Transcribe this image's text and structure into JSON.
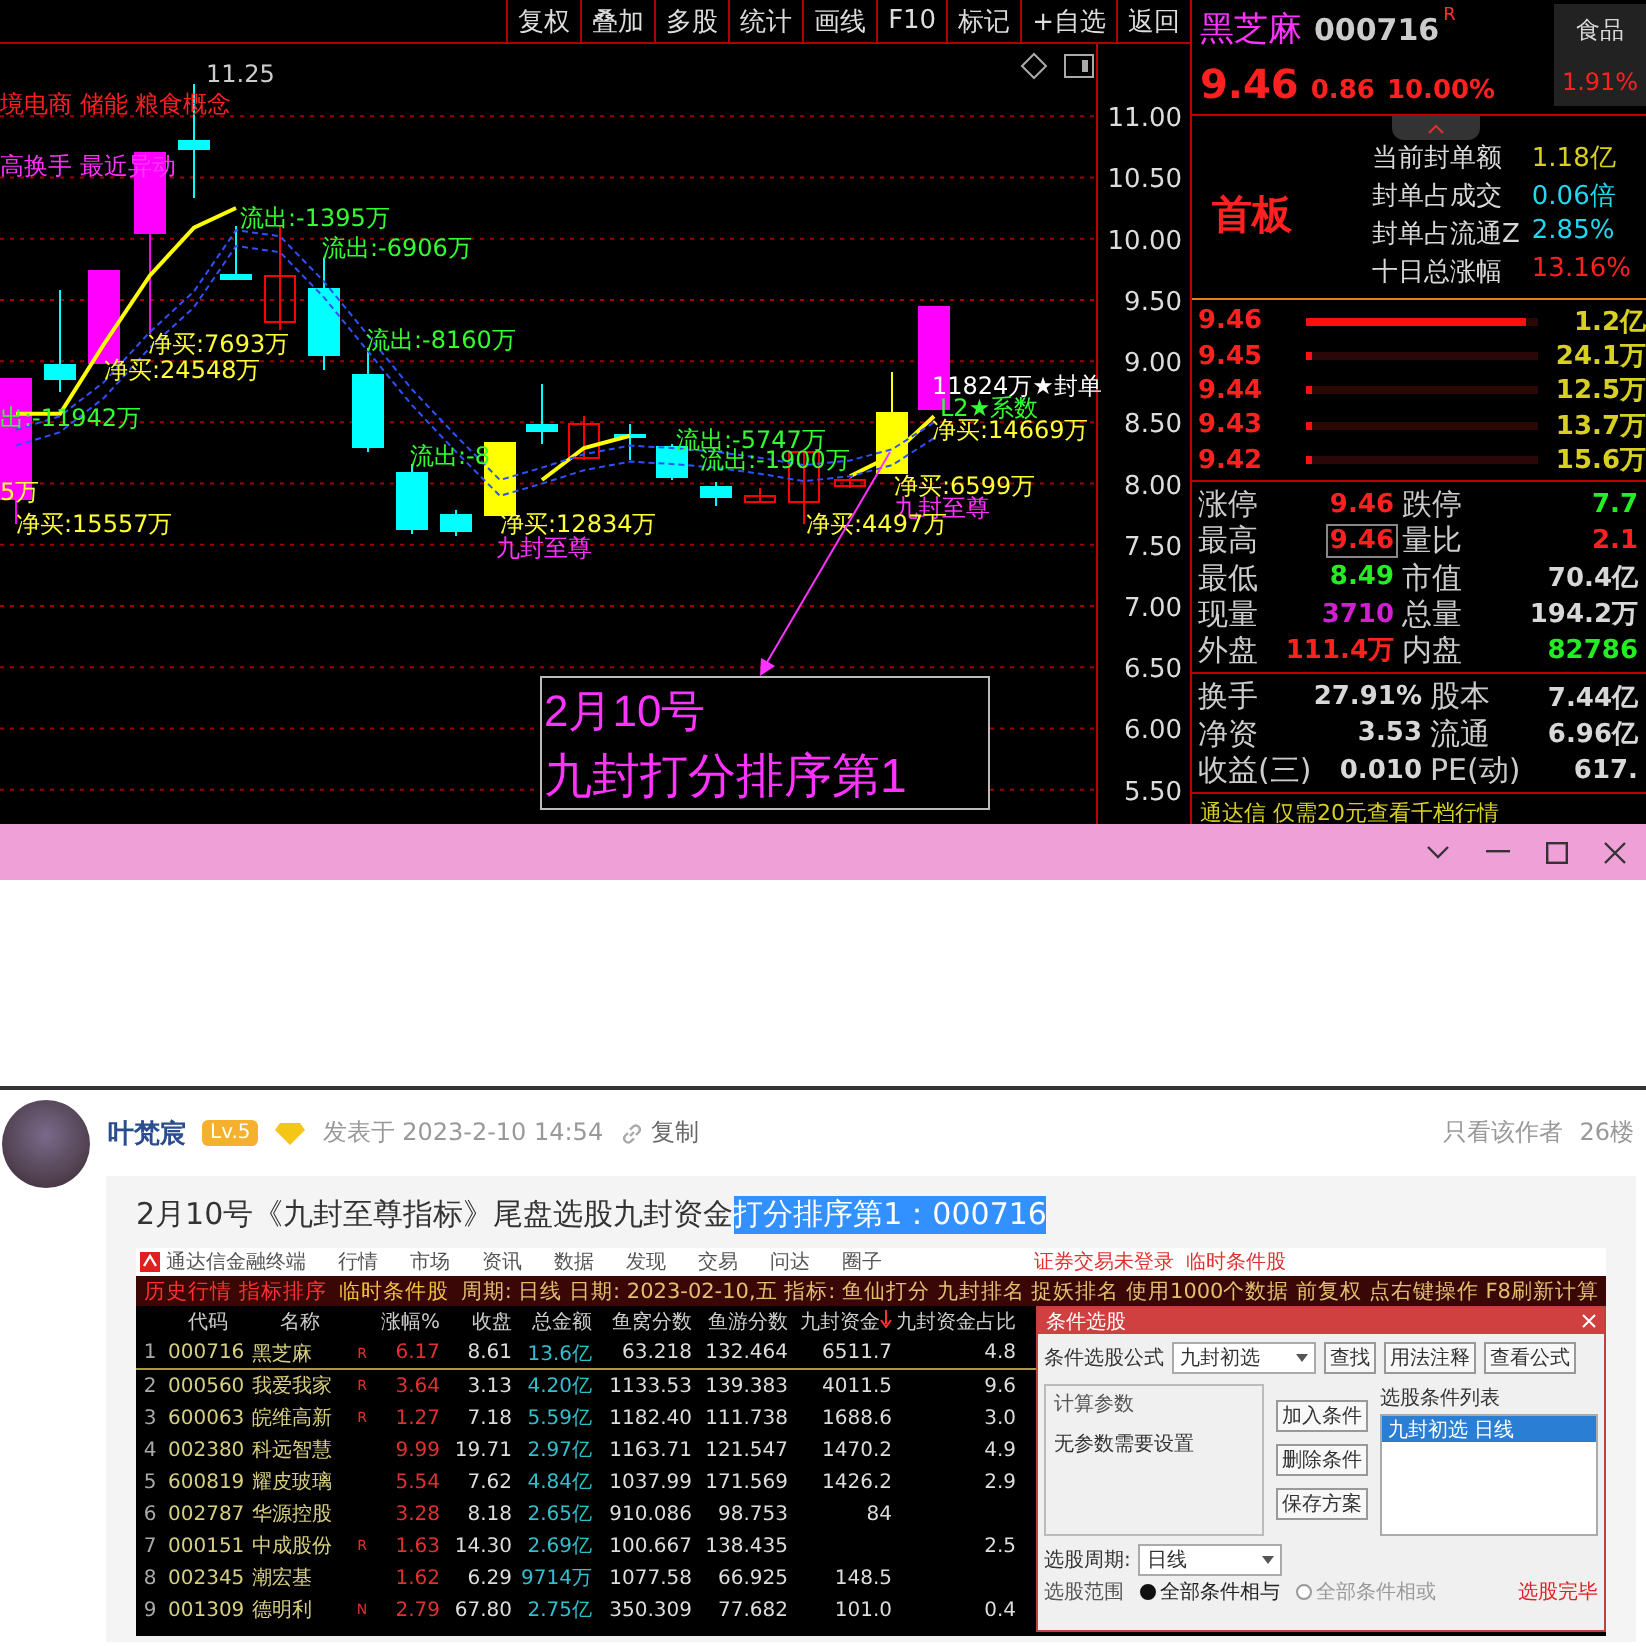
{
  "toolbar": {
    "buttons": [
      "复权",
      "叠加",
      "多股",
      "统计",
      "画线",
      "F10",
      "标记",
      "+自选",
      "返回"
    ]
  },
  "chart": {
    "chart_data": {
      "type": "line",
      "ylim": [
        5.22,
        11.59
      ],
      "grid": true,
      "yticks": [
        {
          "value": 11,
          "label": "11.00"
        },
        {
          "value": 10.5,
          "label": "10.50"
        },
        {
          "value": 10,
          "label": "10.00"
        },
        {
          "value": 9.5,
          "label": "9.50"
        },
        {
          "value": 9,
          "label": "9.00"
        },
        {
          "value": 8.5,
          "label": "8.50"
        },
        {
          "value": 8,
          "label": "8.00"
        },
        {
          "value": 7.5,
          "label": "7.50"
        },
        {
          "value": 7,
          "label": "7.00"
        },
        {
          "value": 6.5,
          "label": "6.50"
        },
        {
          "value": 6,
          "label": "6.00"
        },
        {
          "value": 5.5,
          "label": "5.50"
        }
      ],
      "series": [
        {
          "color": "#ffff00",
          "line_style": "solid",
          "values": [
            8.57,
            8.57,
            9.14,
            9.7,
            10.09,
            10.25,
            null,
            null,
            null,
            null,
            null,
            null,
            8.03,
            8.29,
            8.39,
            null,
            null,
            null,
            null,
            8.06,
            8.23,
            8.55
          ]
        },
        {
          "color": "#3050ff",
          "line_style": "dashed",
          "values": [
            8.44,
            8.55,
            8.83,
            9.24,
            9.57,
            10.07,
            10.02,
            9.65,
            9.21,
            8.77,
            8.39,
            8.03,
            8.13,
            8.24,
            8.31,
            8.29,
            8.26,
            8.21,
            8.15,
            8.19,
            8.28,
            8.5
          ]
        },
        {
          "color": "#3050ff",
          "line_style": "dashed",
          "values": [
            8.31,
            8.42,
            8.7,
            9.11,
            9.44,
            9.94,
            9.89,
            9.52,
            9.08,
            8.64,
            8.26,
            7.9,
            8.0,
            8.11,
            8.18,
            8.16,
            8.13,
            8.08,
            8.02,
            8.06,
            8.15,
            8.37
          ]
        }
      ]
    },
    "tags": [
      {
        "text": "境电商 储能 粮食概念",
        "kind": "concept"
      },
      {
        "text": "高换手 最近异动",
        "kind": "hot"
      }
    ],
    "high_label": "11.25",
    "annotations": [
      {
        "text": "流出:-1395万",
        "kind": "outflow"
      },
      {
        "text": "流出:-6906万",
        "kind": "outflow"
      },
      {
        "text": "净买:7693万",
        "kind": "netbuy"
      },
      {
        "text": "流出:-8160万",
        "kind": "outflow"
      },
      {
        "text": "净买:24548万",
        "kind": "netbuy"
      },
      {
        "text": "11824万★封单",
        "kind": "seal"
      },
      {
        "text": "L2★系数",
        "kind": "coef"
      },
      {
        "text": "出:-11942万",
        "kind": "outflow"
      },
      {
        "text": "流出:-5747万",
        "kind": "outflow"
      },
      {
        "text": "净买:14669万",
        "kind": "netbuy"
      },
      {
        "text": "流出:-8",
        "kind": "outflow"
      },
      {
        "text": "流出:-1900万",
        "kind": "outflow"
      },
      {
        "text": "净买:6599万",
        "kind": "netbuy"
      },
      {
        "text": "5万",
        "kind": "netbuy"
      },
      {
        "text": "九封至尊",
        "kind": "signal"
      },
      {
        "text": "净买:15557万",
        "kind": "netbuy"
      },
      {
        "text": "净买:12834万",
        "kind": "netbuy"
      },
      {
        "text": "净买:4497万",
        "kind": "netbuy"
      },
      {
        "text": "九封至尊",
        "kind": "signal"
      }
    ],
    "callout": [
      "2月10号",
      "九封打分排序第1"
    ]
  },
  "quote": {
    "name": "黑芝麻",
    "code": "000716",
    "flag": "R",
    "price": "9.46",
    "change": "0.86",
    "percent": "10.00%",
    "sector": {
      "name": "食品",
      "percent": "1.91%"
    },
    "board": "首板",
    "metrics": [
      {
        "label": "当前封单额",
        "value": "1.18亿",
        "color": "#d8d020"
      },
      {
        "label": "封单占成交",
        "value": "0.06倍",
        "color": "#22d8ee"
      },
      {
        "label": "封单占流通Z",
        "value": "2.85%",
        "color": "#22d8ee"
      },
      {
        "label": "十日总涨幅",
        "value": "13.16%",
        "color": "#ff2020"
      }
    ],
    "bids": [
      {
        "price": "9.46",
        "level": 0.95,
        "volume": "1.2亿"
      },
      {
        "price": "9.45",
        "level": 0.03,
        "volume": "24.1万"
      },
      {
        "price": "9.44",
        "level": 0.03,
        "volume": "12.5万"
      },
      {
        "price": "9.43",
        "level": 0.03,
        "volume": "13.7万"
      },
      {
        "price": "9.42",
        "level": 0.03,
        "volume": "15.6万"
      }
    ],
    "stats": [
      {
        "label": "涨停",
        "value": "9.46",
        "color": "#ff2020",
        "boxed": false
      },
      {
        "label": "跌停",
        "value": "7.7",
        "color": "#22ee22",
        "boxed": false
      },
      {
        "label": "最高",
        "value": "9.46",
        "color": "#ff2020",
        "boxed": true
      },
      {
        "label": "量比",
        "value": "2.1",
        "color": "#ff2020",
        "boxed": false
      },
      {
        "label": "最低",
        "value": "8.49",
        "color": "#22ee22",
        "boxed": false
      },
      {
        "label": "市值",
        "value": "70.4亿",
        "color": "#d8d8d8",
        "boxed": false
      },
      {
        "label": "现量",
        "value": "3710",
        "color": "#d020d0",
        "boxed": false
      },
      {
        "label": "总量",
        "value": "194.2万",
        "color": "#d8d8d8",
        "boxed": false
      },
      {
        "label": "外盘",
        "value": "111.4万",
        "color": "#ff2020",
        "boxed": false
      },
      {
        "label": "内盘",
        "value": "82786",
        "color": "#22ee22",
        "boxed": false
      }
    ],
    "stats2": [
      {
        "label": "换手",
        "value": "27.91%"
      },
      {
        "label": "股本",
        "value": "7.44亿"
      },
      {
        "label": "净资",
        "value": "3.53"
      },
      {
        "label": "流通",
        "value": "6.96亿"
      },
      {
        "label": "收益(三)",
        "value": "0.010"
      },
      {
        "label": "PE(动)",
        "value": "617."
      }
    ],
    "ticker": "通达信    仅需20元查看千档行情"
  },
  "post": {
    "author": "叶梵宸",
    "level": "Lv.5",
    "posted": "发表于 2023-2-10 14:54",
    "copy": "复制",
    "only_author": "只看该作者",
    "floor": "26楼",
    "text": [
      {
        "text": "2月10号《九封至尊指标》尾盘选股九封资金",
        "selected": false
      },
      {
        "text": "打分排序第1：000716",
        "selected": true
      }
    ],
    "screenshot": {
      "app_title": "通达信金融终端",
      "menu": [
        "行情",
        "市场",
        "资讯",
        "数据",
        "发现",
        "交易",
        "问达",
        "圈子"
      ],
      "notices": [
        "证券交易未登录",
        "临时条件股"
      ],
      "header": [
        {
          "text": "历史行情 指标排序",
          "kind": "mode"
        },
        {
          "text": "临时条件股",
          "kind": "title"
        },
        {
          "text": "周期: 日线 日期: 2023-02-10,五 指标: 鱼仙打分 九封排名 捉妖排名 使用1000个数据 前复权 点右键操作 F8刷新计算",
          "kind": "info"
        }
      ],
      "columns": [
        {
          "label": "代码",
          "sorted": false
        },
        {
          "label": "名称",
          "sorted": false
        },
        {
          "label": "涨幅%",
          "sorted": false
        },
        {
          "label": "收盘",
          "sorted": false
        },
        {
          "label": "总金额",
          "sorted": false
        },
        {
          "label": "鱼窝分数",
          "sorted": false
        },
        {
          "label": "鱼游分数",
          "sorted": false
        },
        {
          "label": "九封资金",
          "sorted": true
        },
        {
          "label": "九封资金占比",
          "sorted": false
        }
      ],
      "rows": [
        {
          "no": "1",
          "code": "000716",
          "name": "黑芝麻",
          "flag": "R",
          "pct": "6.17",
          "close": "8.61",
          "amount": "13.6亿",
          "s1": "63.218",
          "s2": "132.464",
          "fund": "6511.7",
          "ratio": "4.8",
          "selected": true
        },
        {
          "no": "2",
          "code": "000560",
          "name": "我爱我家",
          "flag": "R",
          "pct": "3.64",
          "close": "3.13",
          "amount": "4.20亿",
          "s1": "1133.53",
          "s2": "139.383",
          "fund": "4011.5",
          "ratio": "9.6",
          "selected": false
        },
        {
          "no": "3",
          "code": "600063",
          "name": "皖维高新",
          "flag": "R",
          "pct": "1.27",
          "close": "7.18",
          "amount": "5.59亿",
          "s1": "1182.40",
          "s2": "111.738",
          "fund": "1688.6",
          "ratio": "3.0",
          "selected": false
        },
        {
          "no": "4",
          "code": "002380",
          "name": "科远智慧",
          "pct": "9.99",
          "close": "19.71",
          "amount": "2.97亿",
          "s1": "1163.71",
          "s2": "121.547",
          "fund": "1470.2",
          "ratio": "4.9",
          "selected": false
        },
        {
          "no": "5",
          "code": "600819",
          "name": "耀皮玻璃",
          "pct": "5.54",
          "close": "7.62",
          "amount": "4.84亿",
          "s1": "1037.99",
          "s2": "171.569",
          "fund": "1426.2",
          "ratio": "2.9",
          "selected": false
        },
        {
          "no": "6",
          "code": "002787",
          "name": "华源控股",
          "pct": "3.28",
          "close": "8.18",
          "amount": "2.65亿",
          "s1": "910.086",
          "s2": "98.753",
          "fund": "84",
          "selected": false
        },
        {
          "no": "7",
          "code": "000151",
          "name": "中成股份",
          "flag": "R",
          "pct": "1.63",
          "close": "14.30",
          "amount": "2.69亿",
          "s1": "100.667",
          "s2": "138.435",
          "ratio": "2.5",
          "selected": false
        },
        {
          "no": "8",
          "code": "002345",
          "name": "潮宏基",
          "pct": "1.62",
          "close": "6.29",
          "amount": "9714万",
          "s1": "1077.58",
          "s2": "66.925",
          "fund": "148.5",
          "selected": false
        },
        {
          "no": "9",
          "code": "001309",
          "name": "德明利",
          "flag": "N",
          "pct": "2.79",
          "close": "67.80",
          "amount": "2.75亿",
          "s1": "350.309",
          "s2": "77.682",
          "fund": "101.0",
          "ratio": "0.4",
          "selected": false
        }
      ],
      "dialog": {
        "title": "条件选股",
        "formula_label": "条件选股公式",
        "formula": "九封初选",
        "buttons": [
          "查找",
          "用法注释",
          "查看公式"
        ],
        "params_group": "计算参数",
        "params_note": "无参数需要设置",
        "actions": [
          "加入条件",
          "删除条件",
          "保存方案"
        ],
        "list_label": "选股条件列表",
        "list": [
          {
            "text": "九封初选  日线",
            "selected": true
          }
        ],
        "period_label": "选股周期:",
        "period": "日线",
        "range_label": "选股范围",
        "modes": [
          {
            "label": "全部条件相与",
            "selected": true
          },
          {
            "label": "全部条件相或",
            "selected": false
          }
        ],
        "status": "选股完毕"
      }
    }
  }
}
